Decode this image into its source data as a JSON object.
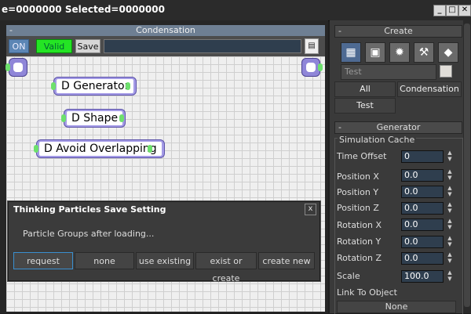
{
  "window": {
    "title": "e=0000000  Selected=0000000",
    "buttons": [
      "_",
      "□",
      "✕"
    ]
  },
  "graph": {
    "header": "Condensation",
    "collapse": "-",
    "toolbar": {
      "on": "ON",
      "valid": "Valid",
      "save": "Save",
      "field_value": ""
    },
    "nodes": [
      {
        "label": "D Generator"
      },
      {
        "label": "D Shape"
      },
      {
        "label": "D Avoid Overlapping"
      }
    ]
  },
  "dialog": {
    "title": "Thinking Particles Save Setting",
    "close": "x",
    "message": "Particle Groups after loading...",
    "buttons": [
      "request",
      "none",
      "use existing",
      "exist or create",
      "create new"
    ]
  },
  "create_rollout": {
    "title": "Create",
    "collapse": "-",
    "icons": [
      "grid-add-icon",
      "tools-icon",
      "gear-icon",
      "wrench-icon",
      "cube-icon"
    ],
    "name_field": "Test",
    "tabs": [
      "All",
      "Condensation",
      "Test"
    ]
  },
  "generator_rollout": {
    "title": "Generator",
    "collapse": "-",
    "group": "Simulation Cache",
    "params": [
      {
        "label": "Time Offset",
        "value": "0"
      },
      {
        "label": "Position X",
        "value": "0.0"
      },
      {
        "label": "Position Y",
        "value": "0.0"
      },
      {
        "label": "Position Z",
        "value": "0.0"
      },
      {
        "label": "Rotation X",
        "value": "0.0"
      },
      {
        "label": "Rotation Y",
        "value": "0.0"
      },
      {
        "label": "Rotation Z",
        "value": "0.0"
      },
      {
        "label": "Scale",
        "value": "100.0"
      }
    ],
    "link_label": "Link To Object",
    "link_value": "None"
  },
  "colors": {
    "valid_green": "#24e424",
    "on_blue": "#5c86b5",
    "node_purple": "#a49be6",
    "port_green": "#6de06d"
  }
}
